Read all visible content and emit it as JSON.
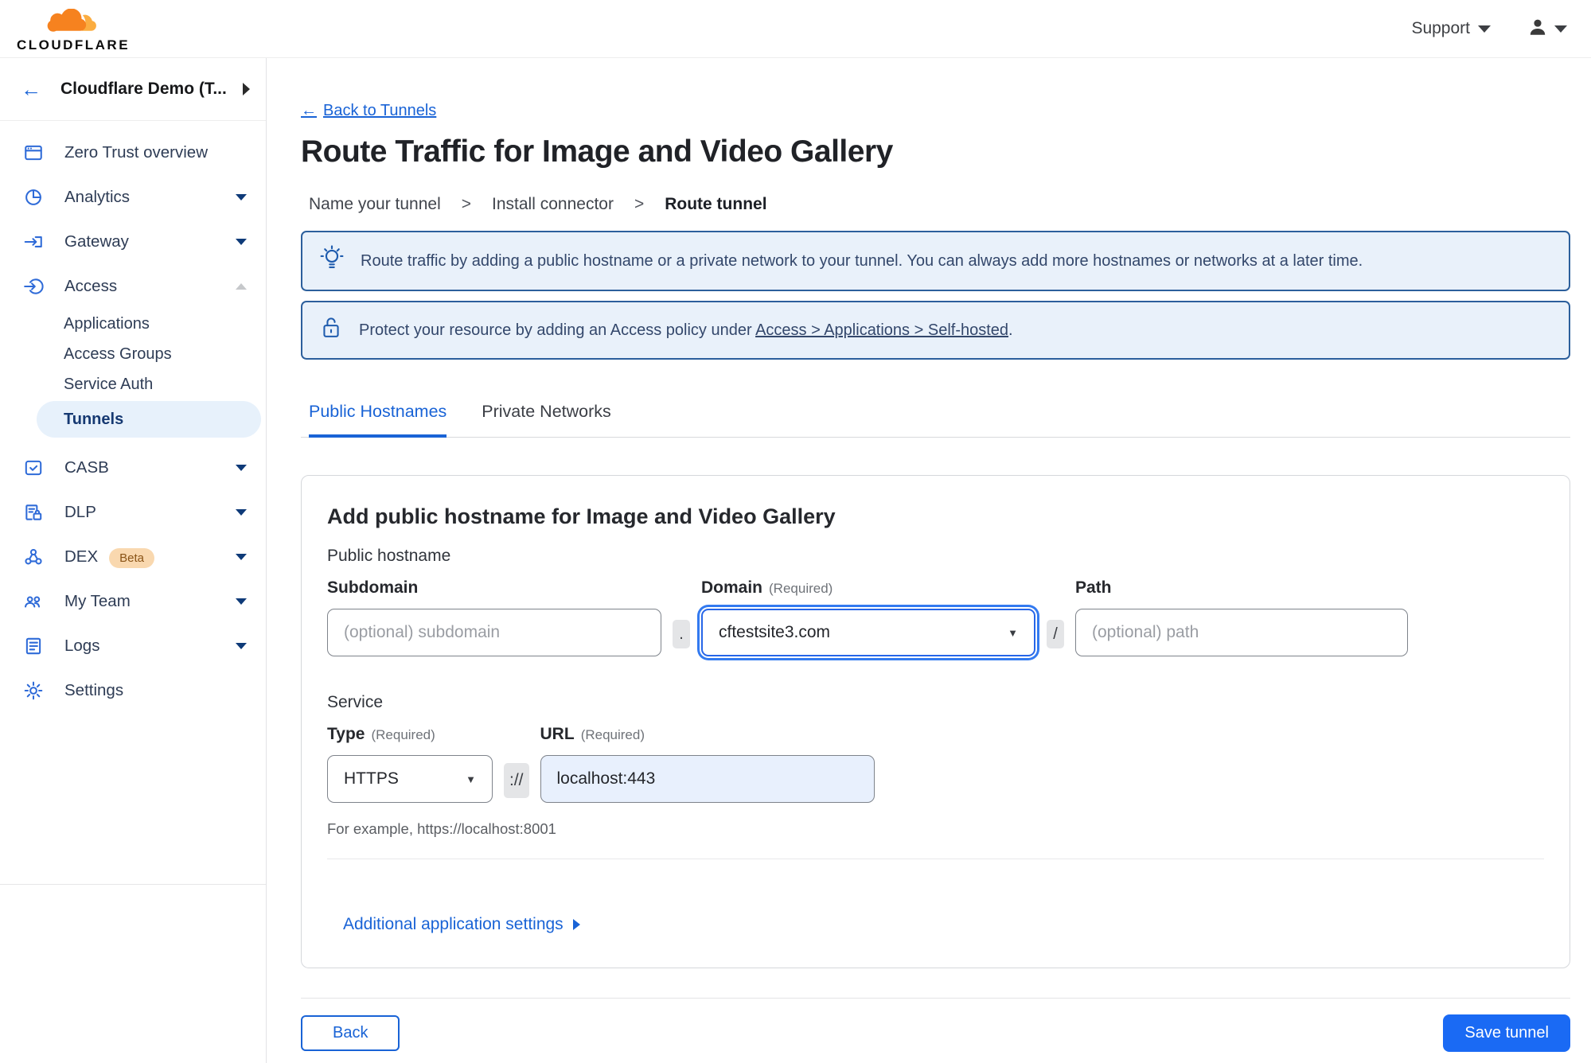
{
  "header": {
    "brand": "CLOUDFLARE",
    "support_label": "Support"
  },
  "sidebar": {
    "account_label": "Cloudflare Demo (T...",
    "items": [
      {
        "label": "Zero Trust overview",
        "icon": "overview-icon",
        "chevron": "none"
      },
      {
        "label": "Analytics",
        "icon": "analytics-icon",
        "chevron": "down"
      },
      {
        "label": "Gateway",
        "icon": "gateway-icon",
        "chevron": "down"
      },
      {
        "label": "Access",
        "icon": "access-icon",
        "chevron": "up"
      },
      {
        "label": "CASB",
        "icon": "casb-icon",
        "chevron": "down"
      },
      {
        "label": "DLP",
        "icon": "dlp-icon",
        "chevron": "down"
      },
      {
        "label": "DEX",
        "icon": "dex-icon",
        "badge": "Beta",
        "chevron": "down"
      },
      {
        "label": "My Team",
        "icon": "my-team-icon",
        "chevron": "down"
      },
      {
        "label": "Logs",
        "icon": "logs-icon",
        "chevron": "down"
      },
      {
        "label": "Settings",
        "icon": "settings-icon",
        "chevron": "none"
      }
    ],
    "access_children": [
      {
        "label": "Applications",
        "active": false
      },
      {
        "label": "Access Groups",
        "active": false
      },
      {
        "label": "Service Auth",
        "active": false
      },
      {
        "label": "Tunnels",
        "active": true
      }
    ]
  },
  "main": {
    "back_label": "Back to Tunnels",
    "title": "Route Traffic for Image and Video Gallery",
    "steps": [
      "Name your tunnel",
      "Install connector",
      "Route tunnel"
    ],
    "banners": [
      {
        "icon": "lightbulb-icon",
        "text": "Route traffic by adding a public hostname or a private network to your tunnel. You can always add more hostnames or networks at a later time."
      },
      {
        "icon": "lock-icon",
        "prefix": "Protect your resource by adding an Access policy under ",
        "link": "Access > Applications > Self-hosted",
        "suffix": "."
      }
    ],
    "tabs": [
      {
        "label": "Public Hostnames",
        "active": true
      },
      {
        "label": "Private Networks",
        "active": false
      }
    ]
  },
  "form": {
    "heading": "Add public hostname for Image and Video Gallery",
    "section1": "Public hostname",
    "subdomain_label": "Subdomain",
    "subdomain_placeholder": "(optional) subdomain",
    "domain_label": "Domain",
    "required_hint": "(Required)",
    "domain_value": "cftestsite3.com",
    "path_label": "Path",
    "path_placeholder": "(optional) path",
    "section2": "Service",
    "type_label": "Type",
    "type_value": "HTTPS",
    "url_label": "URL",
    "url_value": "localhost:443",
    "separators": {
      "dot": ".",
      "slash": "/",
      "scheme": "://"
    },
    "example": "For example, https://localhost:8001",
    "additional_label": "Additional application settings"
  },
  "footer": {
    "back_label": "Back",
    "save_label": "Save tunnel"
  },
  "icons": {
    "back_arrow": "←",
    "step_separator": ">",
    "caret_down": "▼"
  },
  "colors": {
    "accent_blue": "#1963d6",
    "save_button_blue": "#1a6af4",
    "banner_border": "#2c5f9c",
    "banner_bg": "#e9f1fa",
    "nav_active_bg": "#e7f1fb",
    "nav_active_text": "#163972",
    "beta_badge_bg": "#f9d8af",
    "beta_badge_text": "#8a5417",
    "logo_orange": "#f6821f",
    "logo_orange_light": "#fbad41",
    "url_field_bg": "#e8f0fd"
  }
}
